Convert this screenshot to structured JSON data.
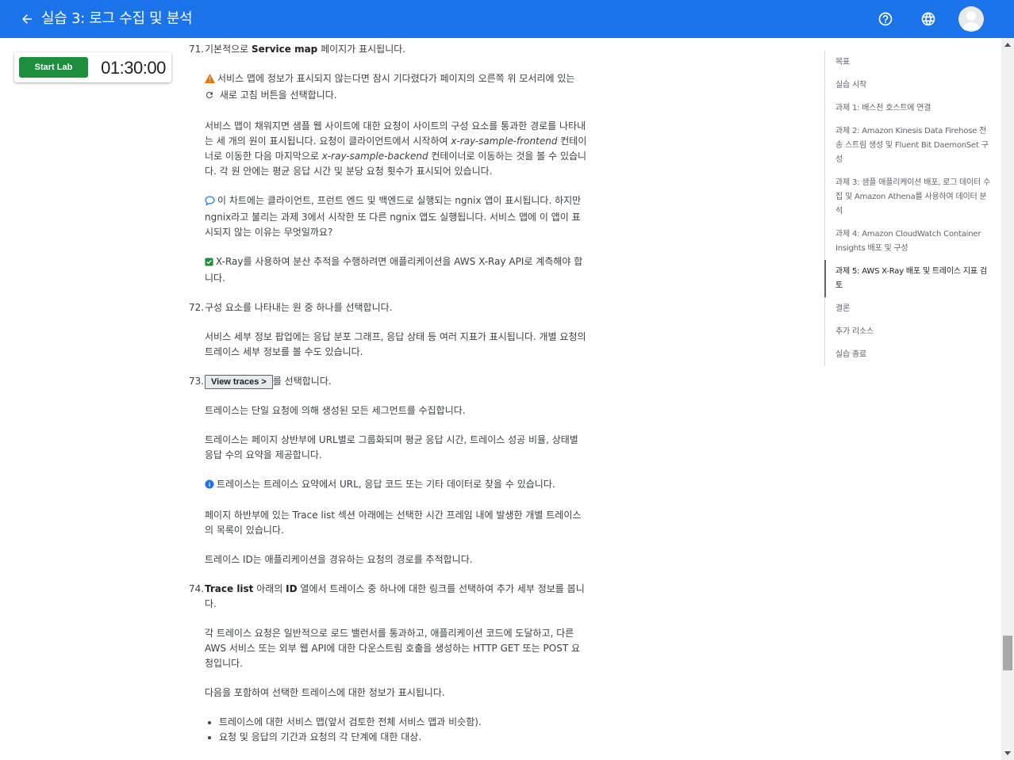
{
  "header": {
    "title": "실습 3: 로그 수집 및 분석",
    "back_icon": "arrow-left-icon",
    "help_icon": "help-circle-icon",
    "language_icon": "globe-icon",
    "avatar_icon": "account-avatar-icon",
    "bg_color": "#1a73e8"
  },
  "lab_control": {
    "start_label": "Start Lab",
    "timer": "01:30:00",
    "button_color": "#1e8e3e"
  },
  "steps": {
    "s71": {
      "num": "71.",
      "pre": "기본적으로 ",
      "bold": "Service map",
      "post": " 페이지가 표시됩니다.",
      "warn_text1": "서비스 맵에 정보가 표시되지 않는다면 잠시 기다렸다가 페이지의 오른쪽 위 모서리에 있는 ",
      "warn_text2": " 새로 고침 버튼을 선택합니다.",
      "p2_a": "서비스 맵이 채워지면 샘플 웹 사이트에 대한 요청이 사이트의 구성 요소를 통과한 경로를 나타내는 세 개의 원이 표시됩니다. 요청이 클라이언트에서 시작하여 ",
      "p2_i1": "x-ray-sample-frontend",
      "p2_b": " 컨테이너로 이동한 다음 마지막으로 ",
      "p2_i2": "x-ray-sample-backend",
      "p2_c": " 컨테이너로 이동하는 것을 볼 수 있습니다. 각 원 안에는 평균 응답 시간 및 분당 요청 횟수가 표시되어 있습니다.",
      "question": "이 차트에는 클라이언트, 프런트 엔드 및 백엔드로 실행되는 ngnix 앱이 표시됩니다. 하지만 ngnix라고 불리는 과제 3에서 시작한 또 다른 ngnix 앱도 실행됩니다. 서비스 맵에 이 앱이 표시되지 않는 이유는 무엇일까요?",
      "answer": "X-Ray를 사용하여 분산 추적을 수행하려면 애플리케이션을 AWS X-Ray API로 계측해야 합니다."
    },
    "s72": {
      "num": "72.",
      "text": "구성 요소를 나타내는 원 중 하나를 선택합니다.",
      "p2": "서비스 세부 정보 팝업에는 응답 분포 그래프, 응답 상태 등 여러 지표가 표시됩니다. 개별 요청의 트레이스 세부 정보를 볼 수도 있습니다."
    },
    "s73": {
      "num": "73.",
      "button": "View traces >",
      "post": "를 선택합니다.",
      "p2": "트레이스는 단일 요청에 의해 생성된 모든 세그먼트를 수집합니다.",
      "p3": "트레이스는 페이지 상반부에 URL별로 그룹화되며 평균 응답 시간, 트레이스 성공 비율, 상태별 응답 수의 요약을 제공합니다.",
      "info": "트레이스는 트레이스 요약에서 URL, 응답 코드 또는 기타 데이터로 찾을 수 있습니다.",
      "p5": "페이지 하반부에 있는 Trace list 섹션 아래에는 선택한 시간 프레임 내에 발생한 개별 트레이스의 목록이 있습니다.",
      "p6": "트레이스 ID는 애플리케이션을 경유하는 요청의 경로를 추적합니다."
    },
    "s74": {
      "num": "74.",
      "bold1": "Trace list",
      "mid1": " 아래의 ",
      "bold2": "ID",
      "post": " 열에서 트레이스 중 하나에 대한 링크를 선택하여 추가 세부 정보를 봅니다.",
      "p2": "각 트레이스 요청은 일반적으로 로드 밸런서를 통과하고, 애플리케이션 코드에 도달하고, 다른 AWS 서비스 또는 외부 웹 API에 대한 다운스트림 호출을 생성하는 HTTP GET 또는 POST 요청입니다.",
      "p3": "다음을 포함하여 선택한 트레이스에 대한 정보가 표시됩니다.",
      "bullets": [
        "트레이스에 대한 서비스 맵(앞서 검토한 전체 서비스 맵과 비슷함).",
        "요청 및 응답의 기간과 요청의 각 단계에 대한 대상."
      ]
    }
  },
  "toc": {
    "items": [
      "목표",
      "실습 시작",
      "과제 1: 배스천 호스트에 연결",
      "과제 2: Amazon Kinesis Data Firehose 전송 스트림 생성 및 Fluent Bit DaemonSet 구성",
      "과제 3: 샘플 애플리케이션 배포, 로그 데이터 수집 및 Amazon Athena를 사용하여 데이터 분석",
      "과제 4: Amazon CloudWatch Container Insights 배포 및 구성",
      "과제 5: AWS X-Ray 배포 및 트레이스 지표 검토",
      "결론",
      "추가 리소스",
      "실습 종료"
    ],
    "active": "과제 5: AWS X-Ray 배포 및 트레이스 지표 검토"
  },
  "icons": {
    "warning": "warning-triangle-icon",
    "refresh": "refresh-icon",
    "question": "speech-bubble-icon",
    "answer": "check-box-icon",
    "info": "info-circle-icon"
  },
  "colors": {
    "warning": "#e8710a",
    "answer": "#1e8e3e",
    "info": "#1a73e8",
    "question": "#1a73e8"
  }
}
